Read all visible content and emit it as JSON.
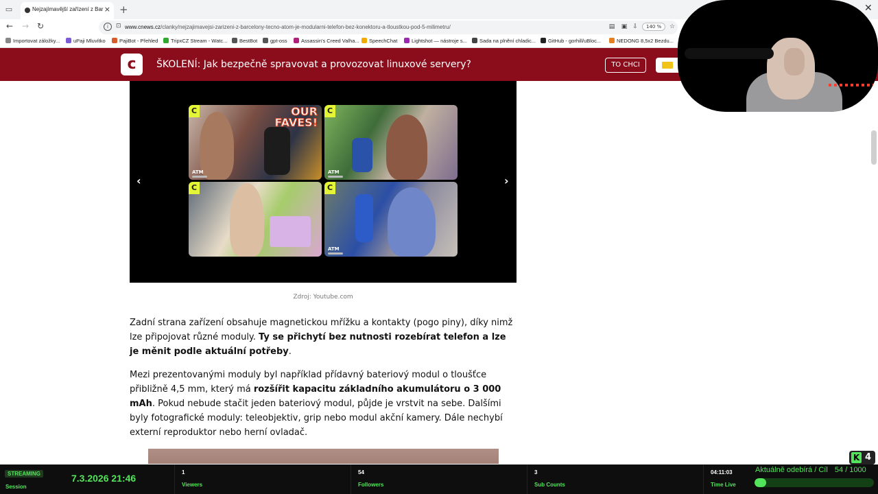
{
  "browser": {
    "tab_title": "Nejzajímavější zařízení z Barcelo",
    "url_host": "www.cnews.cz",
    "url_path": "/clanky/nejzajimavejsi-zarizeni-z-barcelony-tecno-atom-je-modularni-telefon-bez-konektoru-a-tloustkou-pod-5-milimetru/",
    "zoom": "140 %",
    "bookmarks": [
      {
        "label": "Importovat záložky...",
        "color": "#888888"
      },
      {
        "label": "uPaji Mluvítko",
        "color": "#7b5cd6"
      },
      {
        "label": "PajiBot - Přehled",
        "color": "#d65c2b"
      },
      {
        "label": "TripxCZ Stream - Watc...",
        "color": "#2faa2f"
      },
      {
        "label": "BestBot",
        "color": "#555555"
      },
      {
        "label": "gpt-oss",
        "color": "#555555"
      },
      {
        "label": "Assassin's Creed Valha...",
        "color": "#b01f7a"
      },
      {
        "label": "SpeechChat",
        "color": "#f2a900"
      },
      {
        "label": "Lightshot — nástroje s...",
        "color": "#9c27b0"
      },
      {
        "label": "Sada na plnění chladic...",
        "color": "#444444"
      },
      {
        "label": "GitHub - gorhill/uBloc...",
        "color": "#222222"
      },
      {
        "label": "NEDONG 8,5x2 Bezdu...",
        "color": "#e67e22"
      }
    ]
  },
  "promo": {
    "logo": "c",
    "text": "ŠKOLENÍ: Jak bezpečně spravovat a provozovat linuxové servery?",
    "button": "TO CHCI"
  },
  "article": {
    "carousel": {
      "thumbs": [
        {
          "badge": "C",
          "overlay": "OUR\nFAVES!",
          "atm": "ATM"
        },
        {
          "badge": "C",
          "overlay": "",
          "atm": "ATM"
        },
        {
          "badge": "C",
          "overlay": "",
          "atm": ""
        },
        {
          "badge": "C",
          "overlay": "",
          "atm": "ATM"
        }
      ],
      "prev": "‹",
      "next": "›"
    },
    "caption": "Zdroj: Youtube.com",
    "para1_a": "Zadní strana zařízení obsahuje magnetickou mřížku a kontakty (pogo piny), díky nimž lze připojovat různé moduly. ",
    "para1_b": "Ty se přichytí bez nutnosti rozebírat telefon a lze je měnit podle aktuální potřeby",
    "para1_c": ".",
    "para2_a": "Mezi prezentovanými moduly byl například přídavný bateriový modul o tloušťce přibližně 4,5 mm, který má ",
    "para2_b": "rozšířit kapacitu základního akumulátoru o 3 000 mAh",
    "para2_c": ". Pokud nebude stačit jeden bateriový modul, půjde je vrstvit na sebe. Dalšími byly fotografické moduly: teleobjektiv, grip nebo modul akční kamery. Dále nechybí externí reproduktor nebo herní ovladač."
  },
  "stream": {
    "status": "STREAMING",
    "session_label": "Session",
    "datetime": "7.3.2026 21:46",
    "viewers_value": "1",
    "viewers_label": "Viewers",
    "followers_value": "54",
    "followers_label": "Followers",
    "subs_value": "3",
    "subs_label": "Sub Counts",
    "time_value": "04:11:03",
    "time_label": "Time Live",
    "goal_title": "Aktuálně odebírá / Cíl",
    "goal_count": "54 / 1000",
    "goal_progress": 0.054,
    "kick_count": "4"
  }
}
